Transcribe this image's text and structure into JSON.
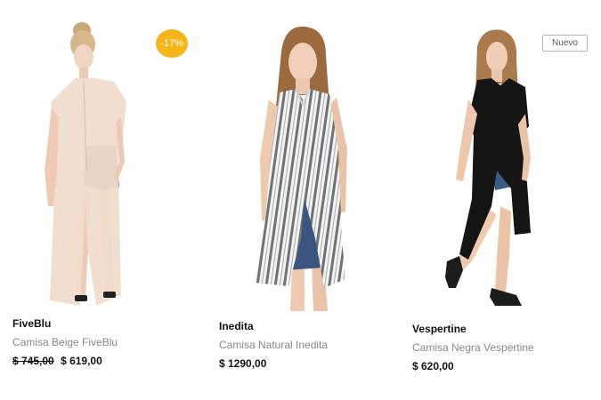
{
  "products": [
    {
      "brand": "FiveBlu",
      "name": "Camisa Beige FiveBlu",
      "old_price": "$ 745,00",
      "price": "$ 619,00",
      "badge": "-17%",
      "badge_color": "#f7b51a",
      "image_icon": "beige-long-shirt-photo"
    },
    {
      "brand": "Inedita",
      "name": "Camisa Natural Inedita",
      "price": "$ 1290,00",
      "image_icon": "striped-sleeveless-shirt-photo"
    },
    {
      "brand": "Vespertine",
      "name": "Camisa Negra Vespertine",
      "price": "$ 620,00",
      "badge": "Nuevo",
      "image_icon": "black-long-shirt-photo"
    }
  ]
}
